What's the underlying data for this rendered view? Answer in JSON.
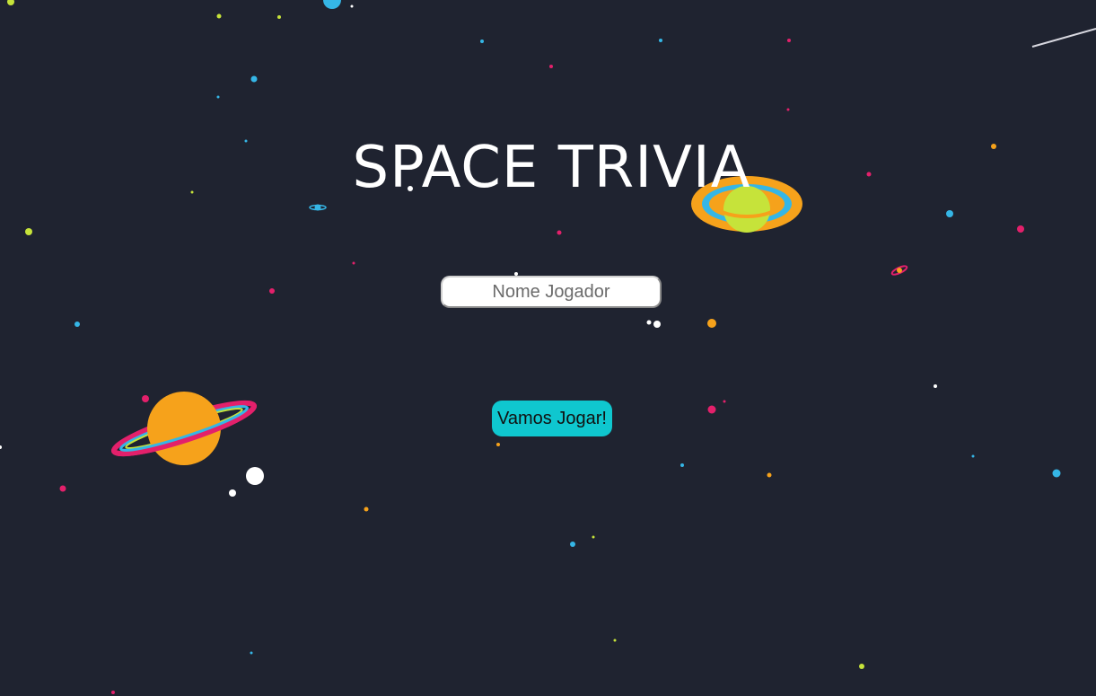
{
  "game": {
    "title": "SPACE TRIVIA",
    "name_input": {
      "placeholder": "Nome Jogador",
      "value": ""
    },
    "play_button_label": "Vamos Jogar!"
  },
  "colors": {
    "background": "#1f2330",
    "accent": "#0fc7cf",
    "star_yellow": "#c6e33a",
    "star_blue": "#35b6e6",
    "star_pink": "#e3206b",
    "star_orange": "#f6a21b",
    "star_white": "#ffffff"
  },
  "icons": [
    "orange-ringed-planet-icon",
    "green-ringed-planet-icon",
    "tiny-ringed-planet-icon",
    "shooting-star-icon"
  ]
}
